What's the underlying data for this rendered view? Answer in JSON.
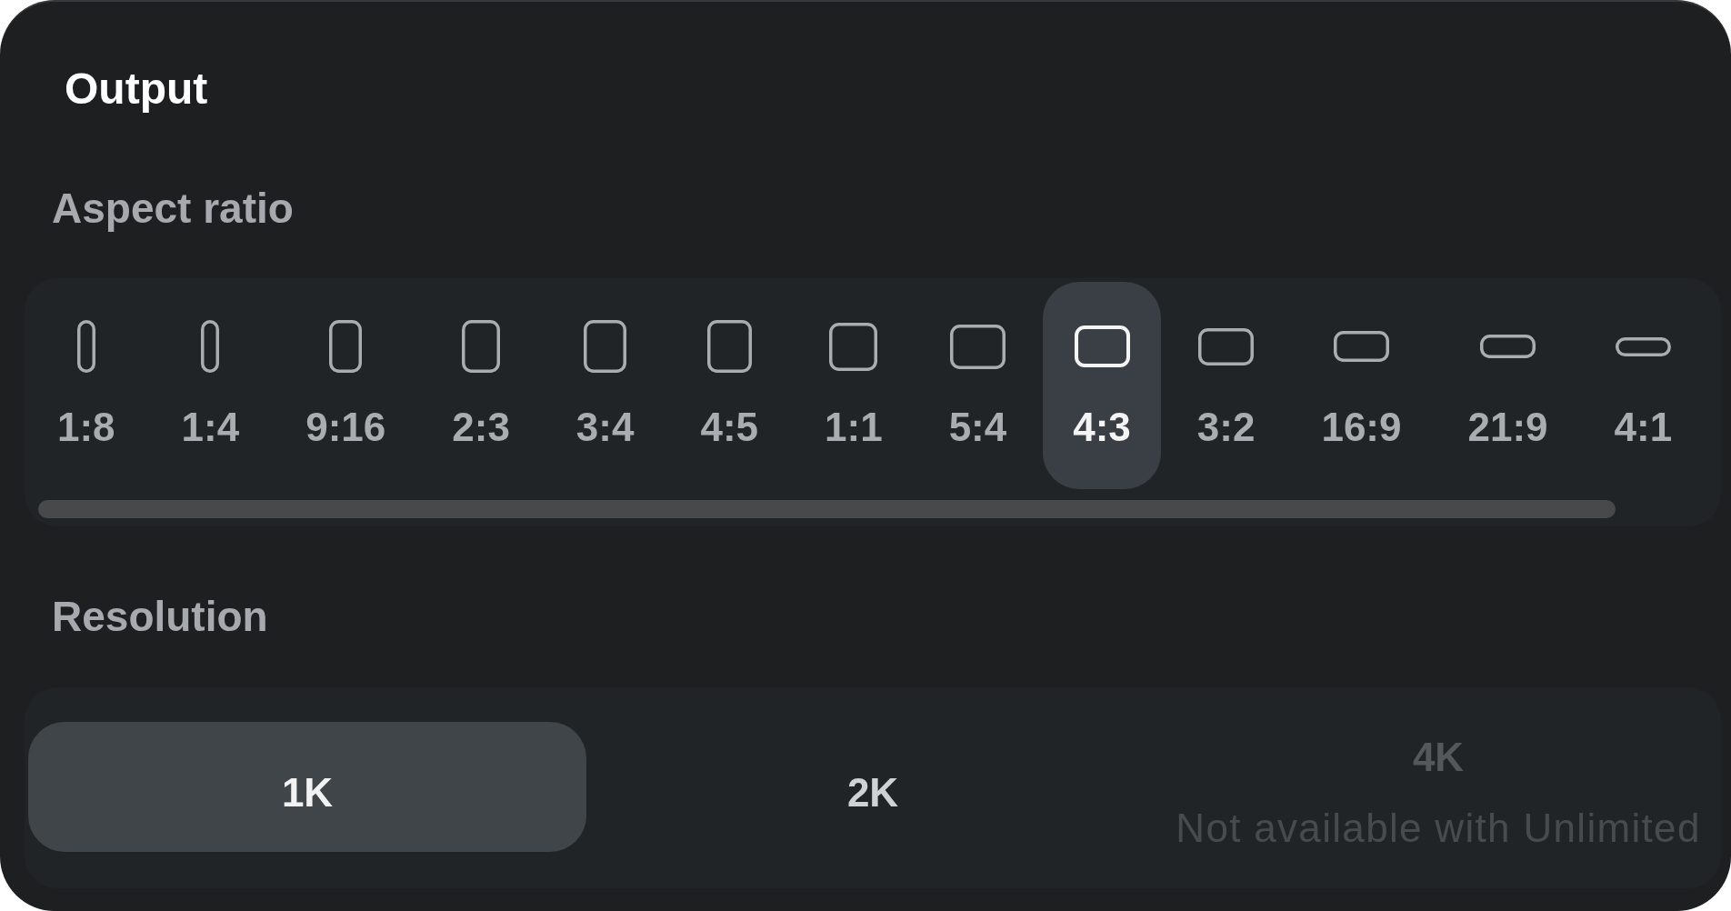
{
  "panel": {
    "title": "Output"
  },
  "aspect_ratio": {
    "label": "Aspect ratio",
    "options": [
      {
        "label": "1:8",
        "selected": false
      },
      {
        "label": "1:4",
        "selected": false
      },
      {
        "label": "9:16",
        "selected": false
      },
      {
        "label": "2:3",
        "selected": false
      },
      {
        "label": "3:4",
        "selected": false
      },
      {
        "label": "4:5",
        "selected": false
      },
      {
        "label": "1:1",
        "selected": false
      },
      {
        "label": "5:4",
        "selected": false
      },
      {
        "label": "4:3",
        "selected": true
      },
      {
        "label": "3:2",
        "selected": false
      },
      {
        "label": "16:9",
        "selected": false
      },
      {
        "label": "21:9",
        "selected": false
      },
      {
        "label": "4:1",
        "selected": false
      }
    ]
  },
  "resolution": {
    "label": "Resolution",
    "options": [
      {
        "label": "1K",
        "selected": true,
        "disabled": false
      },
      {
        "label": "2K",
        "selected": false,
        "disabled": false
      },
      {
        "label": "4K",
        "selected": false,
        "disabled": true,
        "note": "Not available with Unlimited"
      }
    ]
  }
}
